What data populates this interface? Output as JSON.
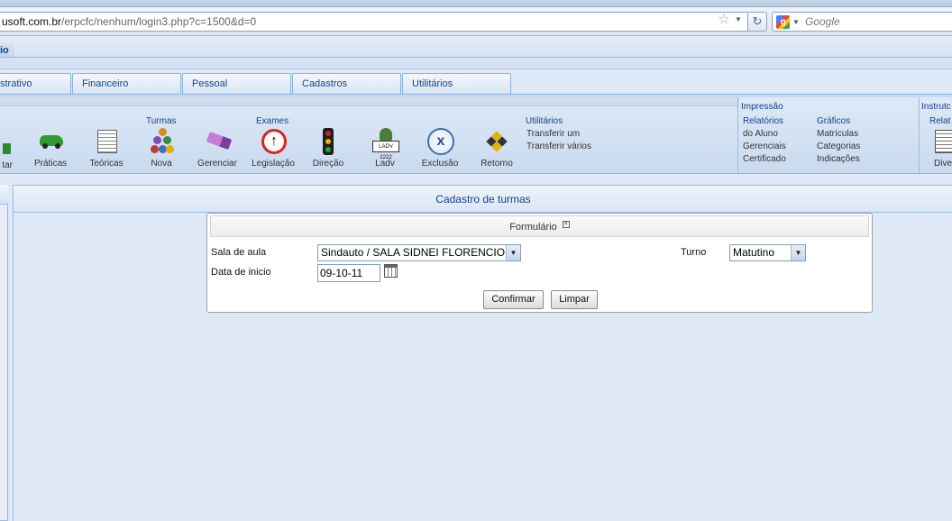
{
  "browser": {
    "url_host": "usoft.com.br",
    "url_path": "/erpcfc/nenhum/login3.php?c=1500&d=0",
    "search_placeholder": "Google"
  },
  "app": {
    "header_title": "io"
  },
  "tabs": [
    {
      "label": "strativo"
    },
    {
      "label": "Financeiro"
    },
    {
      "label": "Pessoal"
    },
    {
      "label": "Cadastros"
    },
    {
      "label": "Utilitários"
    }
  ],
  "ribbon": {
    "partial_left_label": "tar",
    "praticas": "Práticas",
    "teoricas": "Teóricas",
    "turmas_group": "Turmas",
    "nova": "Nova",
    "gerenciar": "Gerenciar",
    "exames_group": "Exames",
    "legislacao": "Legislação",
    "direcao": "Direção",
    "ladv": "Ladv",
    "ladv_stamp": "LADV 2222",
    "exclusao": "Exclusão",
    "retorno": "Retorno",
    "utilitarios_group": "Utilitários",
    "transferir_um": "Transferir um",
    "transferir_varios": "Transferir vários",
    "impressao_group": "Impressão",
    "relatorios": "Relatórios",
    "do_aluno": "do Aluno",
    "gerenciais": "Gerenciais",
    "certificado": "Certificado",
    "graficos": "Gráficos",
    "matriculas": "Matrículas",
    "categorias": "Categorias",
    "indicacoes": "Indicações",
    "instrutor_group": "Instrutc",
    "relat_partial": "Relat",
    "dive_partial": "Dive"
  },
  "main": {
    "title": "Cadastro de turmas"
  },
  "form": {
    "title": "Formulário",
    "close_glyph": "×",
    "sala_label": "Sala de aula",
    "sala_value": "Sindauto / SALA SIDNEI FLORENCIO",
    "turno_label": "Turno",
    "turno_value": "Matutino",
    "data_label": "Data de inicio",
    "data_value": "09-10-11",
    "confirmar": "Confirmar",
    "limpar": "Limpar"
  }
}
